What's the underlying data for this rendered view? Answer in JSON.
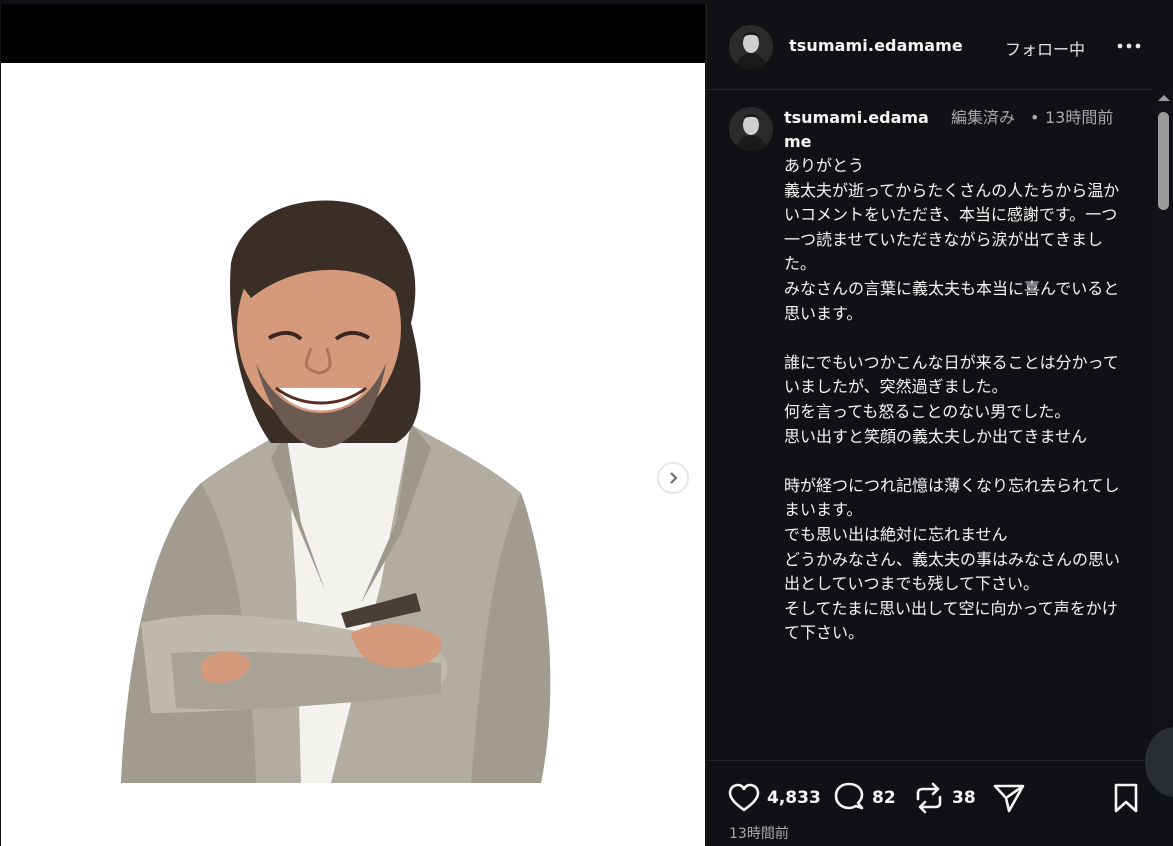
{
  "post": {
    "username": "tsumami.edamame",
    "follow_label": "フォロー中",
    "more_icon": "more-horizontal-icon"
  },
  "comment": {
    "username": "tsumami.edamame",
    "edited_label": "編集済み",
    "dot": "•",
    "time": "13時間前",
    "body": "ありがとう\n義太夫が逝ってからたくさんの人たちから温かいコメントをいただき、本当に感謝です。一つ一つ読ませていただきながら涙が出てきました。\nみなさんの言葉に義太夫も本当に喜んでいると思います。\n\n誰にでもいつかこんな日が来ることは分かっていましたが、突然過ぎました。\n何を言っても怒ることのない男でした。\n思い出すと笑顔の義太夫しか出てきません\n\n時が経つにつれ記憶は薄くなり忘れ去られてしまいます。\nでも思い出は絶対に忘れません\nどうかみなさん、義太夫の事はみなさんの思い出としていつまでも残して下さい。\nそしてたまに思い出して空に向かって声をかけて下さい。"
  },
  "actions": {
    "likes": "4,833",
    "comments": "82",
    "reposts": "38"
  },
  "post_time": "13時間前",
  "colors": {
    "panel_bg": "#0f1115",
    "text": "#f5f5f5",
    "muted": "#a8a8a8"
  }
}
